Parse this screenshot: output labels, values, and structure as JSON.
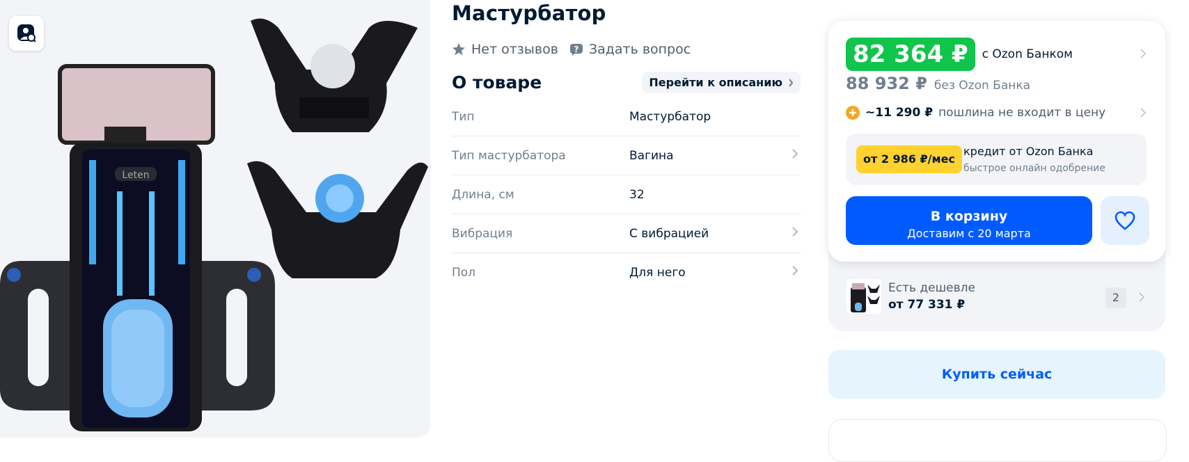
{
  "product": {
    "title": "Мастурбатор",
    "reviews": "Нет отзывов",
    "ask_question": "Задать вопрос"
  },
  "about": {
    "title": "О товаре",
    "description_link": "Перейти к описанию",
    "specs": [
      {
        "label": "Тип",
        "value": "Мастурбатор",
        "has_link": false
      },
      {
        "label": "Тип мастурбатора",
        "value": "Вагина",
        "has_link": true
      },
      {
        "label": "Длина, см",
        "value": "32",
        "has_link": false
      },
      {
        "label": "Вибрация",
        "value": "С вибрацией",
        "has_link": true
      },
      {
        "label": "Пол",
        "value": "Для него",
        "has_link": true
      }
    ]
  },
  "price": {
    "ozon_bank_price": "82 364 ₽",
    "ozon_bank_label": "с Ozon Банком",
    "regular_price": "88 932 ₽",
    "regular_label": "без Ozon Банка",
    "duty_amount": "~11 290 ₽",
    "duty_text": "пошлина не входит в цену",
    "credit_badge": "от 2 986 ₽/мес",
    "credit_title": "кредит от Ozon Банка",
    "credit_sub": "быстрое онлайн одобрение",
    "cart_label": "В корзину",
    "cart_sub": "Доставим с 20 марта"
  },
  "cheaper": {
    "title": "Есть дешевле",
    "price": "от 77 331 ₽",
    "count": "2"
  },
  "buy_now": "Купить сейчас",
  "colors": {
    "accent": "#005bff",
    "price_green": "#10c44c",
    "credit_yellow": "#ffd22f"
  }
}
